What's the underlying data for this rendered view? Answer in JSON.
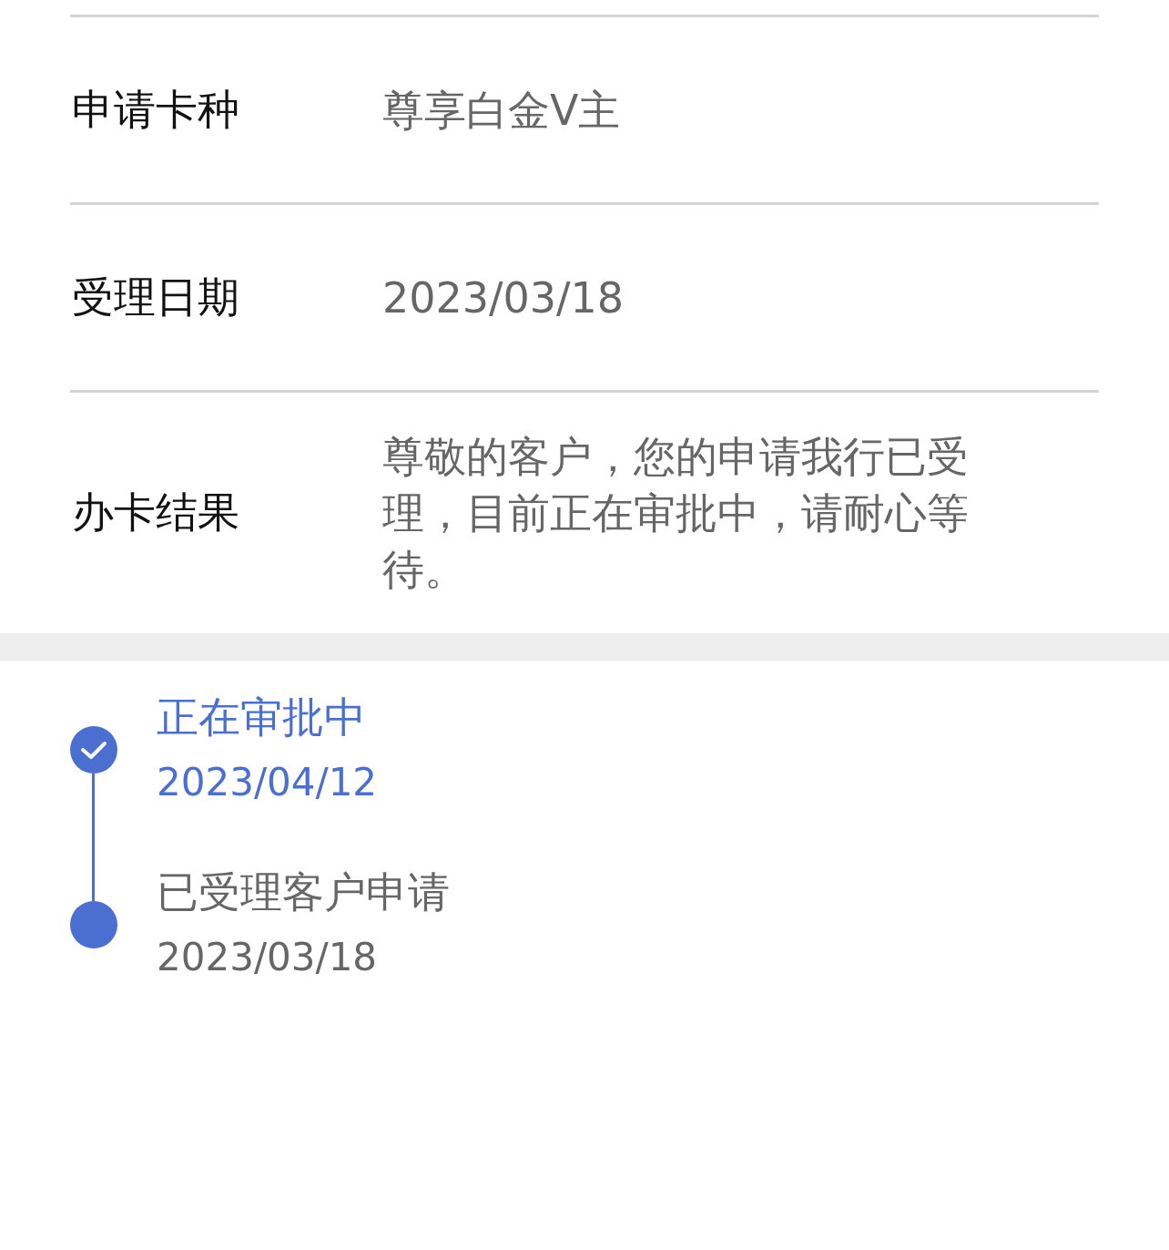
{
  "details": [
    {
      "label": "申请卡种",
      "value": "尊享白金V主"
    },
    {
      "label": "受理日期",
      "value": "2023/03/18"
    },
    {
      "label": "办卡结果",
      "value": "尊敬的客户，您的申请我行已受理，目前正在审批中，请耐心等待。"
    }
  ],
  "timeline": [
    {
      "title": "正在审批中",
      "date": "2023/04/12",
      "current": true
    },
    {
      "title": "已受理客户申请",
      "date": "2023/03/18",
      "current": false
    }
  ]
}
